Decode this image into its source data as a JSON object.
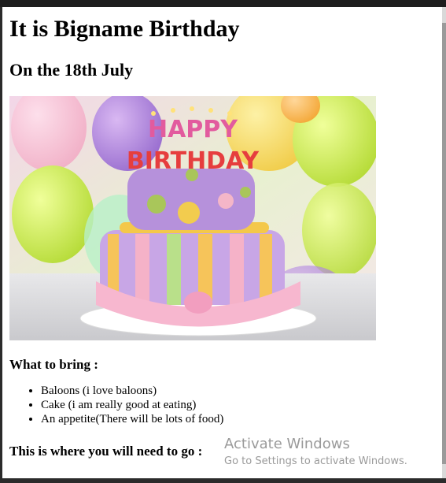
{
  "page": {
    "title": "It is Bigname Birthday",
    "date_heading": "On the 18th July",
    "bring_heading": "What to bring :",
    "bring_items": [
      "Baloons (i love baloons)",
      "Cake (i am really good at eating)",
      "An appetite(There will be lots of food)"
    ],
    "where_heading": "This is where you will need to go :"
  },
  "image": {
    "candle_text": "HAPPY BIRTHDAY"
  },
  "watermark": {
    "title": "Activate Windows",
    "subtitle": "Go to Settings to activate Windows."
  }
}
